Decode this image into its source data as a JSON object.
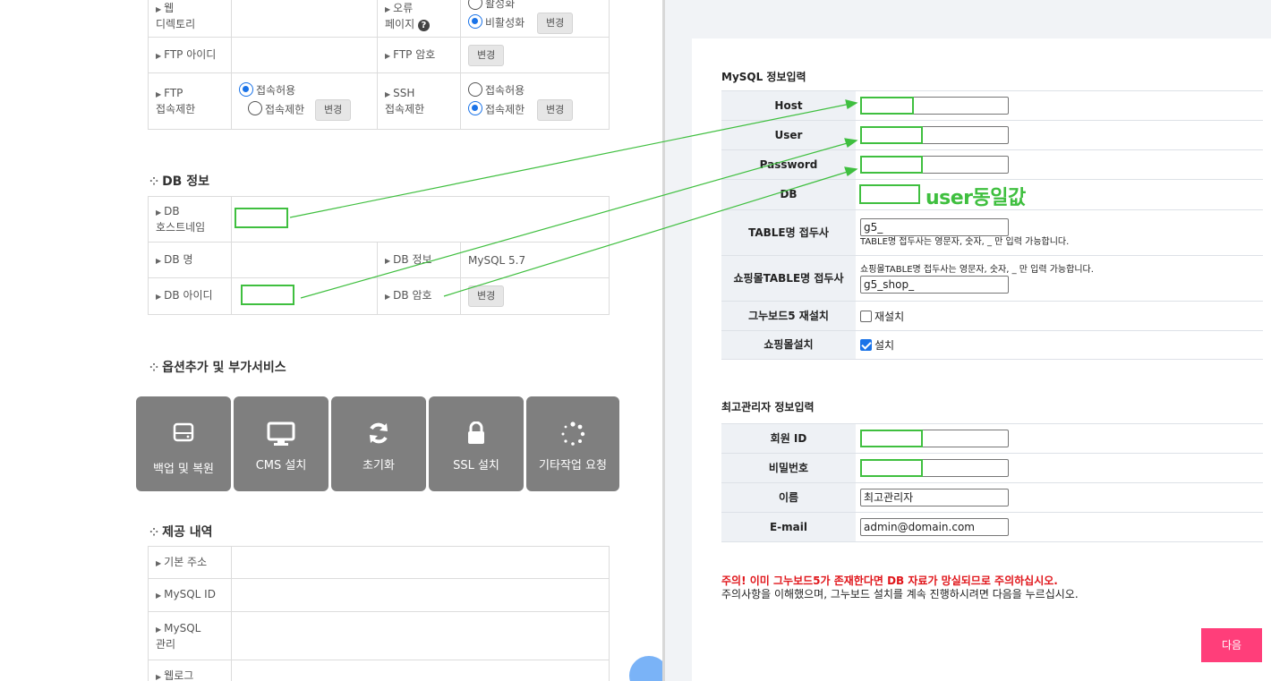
{
  "hosting": {
    "rows_top": [
      {
        "label1": "웹\n디렉토리",
        "label2": "오류\n페이지",
        "radio_a": "활성화",
        "radio_b": "비활성화",
        "btn": "변경"
      },
      {
        "label1": "FTP 아이디",
        "label2": "FTP 암호",
        "btn": "변경"
      },
      {
        "label1": "FTP\n접속제한",
        "radio_a": "접속허용",
        "radio_b": "접속제한",
        "btn": "변경",
        "label2": "SSH\n접속제한",
        "radio2_a": "접속허용",
        "radio2_b": "접속제한",
        "btn2": "변경"
      }
    ]
  },
  "db_section": {
    "title": "DB 정보",
    "host_label_1": "DB",
    "host_label_2": "호스트네임",
    "name_label": "DB 명",
    "info_label": "DB 정보",
    "info_value": "MySQL 5.7",
    "id_label": "DB 아이디",
    "pw_label": "DB 암호",
    "pw_btn": "변경"
  },
  "options_section": {
    "title": "옵션추가 및 부가서비스",
    "tiles": [
      {
        "label": "백업 및 복원",
        "icon": "hdd-icon"
      },
      {
        "label": "CMS 설치",
        "icon": "monitor-icon"
      },
      {
        "label": "초기화",
        "icon": "refresh-icon"
      },
      {
        "label": "SSL 설치",
        "icon": "lock-icon"
      },
      {
        "label": "기타작업 요청",
        "icon": "spinner-icon"
      }
    ]
  },
  "provided_section": {
    "title": "제공 내역",
    "rows": [
      "기본 주소",
      "MySQL ID",
      "MySQL\n관리",
      "웹로그"
    ]
  },
  "installer": {
    "mysql_title": "MySQL 정보입력",
    "host_label": "Host",
    "user_label": "User",
    "password_label": "Password",
    "db_label": "DB",
    "db_annotation": "user동일값",
    "prefix_label": "TABLE명 접두사",
    "prefix_value": "g5_",
    "prefix_hint": "TABLE명 접두사는 영문자, 숫자, _ 만 입력 가능합니다.",
    "shop_prefix_label": "쇼핑몰TABLE명 접두사",
    "shop_prefix_hint": "쇼핑몰TABLE명 접두사는 영문자, 숫자, _ 만 입력 가능합니다.",
    "shop_prefix_value": "g5_shop_",
    "reinstall_label": "그누보드5 재설치",
    "reinstall_option": "재설치",
    "shop_install_label": "쇼핑몰설치",
    "shop_install_option": "설치",
    "admin_title": "최고관리자 정보입력",
    "admin_id_label": "회원 ID",
    "admin_pw_label": "비밀번호",
    "admin_name_label": "이름",
    "admin_name_value": "최고관리자",
    "admin_email_label": "E-mail",
    "admin_email_value": "admin@domain.com",
    "warning_strong": "주의! 이미 그누보드5가 존재한다면 DB 자료가 망실되므로 주의하십시오.",
    "warning_text": "주의사항을 이해했으며, 그누보드 설치를 계속 진행하시려면 다음을 누르십시오.",
    "next_label": "다음"
  },
  "colors": {
    "annotation_green": "#3fbf3f",
    "next_button": "#ff3e7a",
    "warning_red": "#e0161b",
    "radio_blue": "#1a73e8"
  }
}
